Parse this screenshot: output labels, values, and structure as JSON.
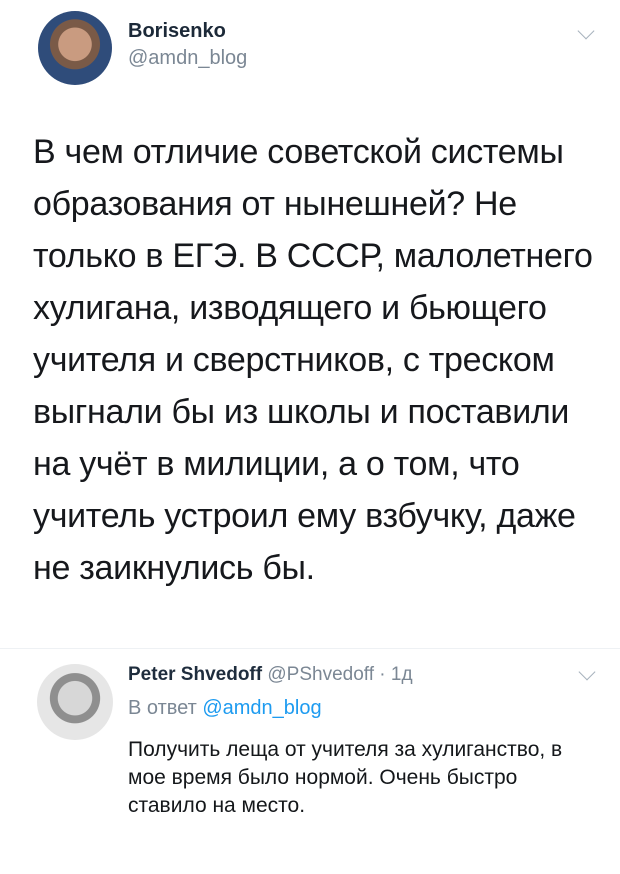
{
  "tweet": {
    "author_name": "Borisenko",
    "author_handle": "@amdn_blog",
    "text": "В чем отличие советской системы образования от нынешней? Не только в ЕГЭ. В СССР, малолетнего хулигана, изводящего и бьющего учителя и сверстников, с треском выгнали бы из школы и поставили на учёт в милиции, а о том, что учитель устроил ему взбучку, даже не заикнулись бы."
  },
  "reply": {
    "author_name": "Peter Shvedoff",
    "author_handle": "@PShvedoff",
    "separator": " · ",
    "time": "1д",
    "reply_prefix": "В ответ ",
    "reply_to_handle": "@amdn_blog",
    "text": "Получить леща от учителя за хулиганство, в мое время было нормой. Очень быстро ставило на место."
  },
  "icons": {
    "main_menu": "chevron-down-icon",
    "reply_menu": "chevron-down-icon"
  }
}
